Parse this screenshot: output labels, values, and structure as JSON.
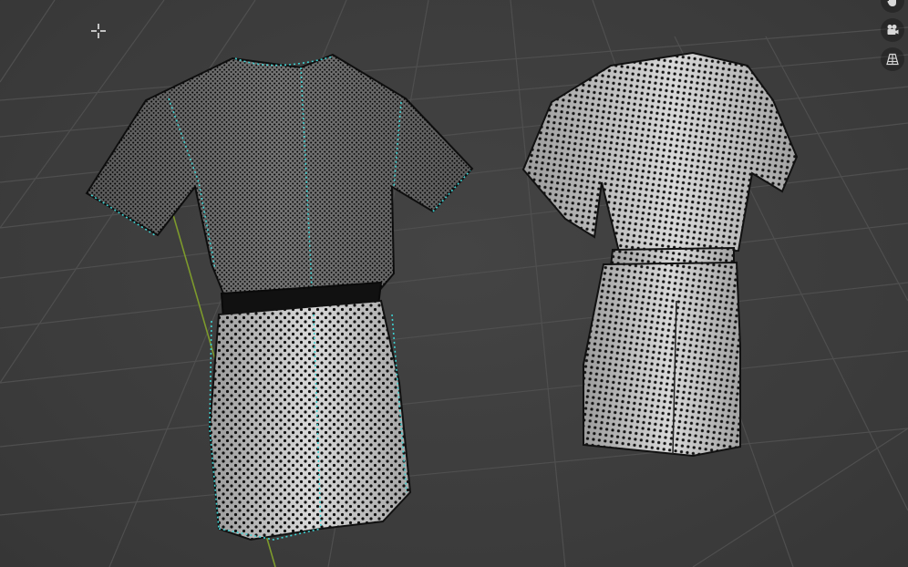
{
  "viewport": {
    "name": "3D Viewport",
    "background": "#3d3d3d",
    "grid_color": "#4e4e4e",
    "y_axis_color": "#7d9a2c"
  },
  "garments": [
    {
      "name": "garment-left",
      "shading": "dense-black-vertices",
      "seam_color": "#3ed2d2"
    },
    {
      "name": "garment-right",
      "shading": "grid-vertices"
    }
  ],
  "navigation": {
    "buttons": [
      {
        "icon": "hand-pan-icon"
      },
      {
        "icon": "camera-icon"
      },
      {
        "icon": "perspective-grid-icon"
      }
    ]
  },
  "cursor": {
    "icon": "crosshair-cursor-icon"
  }
}
